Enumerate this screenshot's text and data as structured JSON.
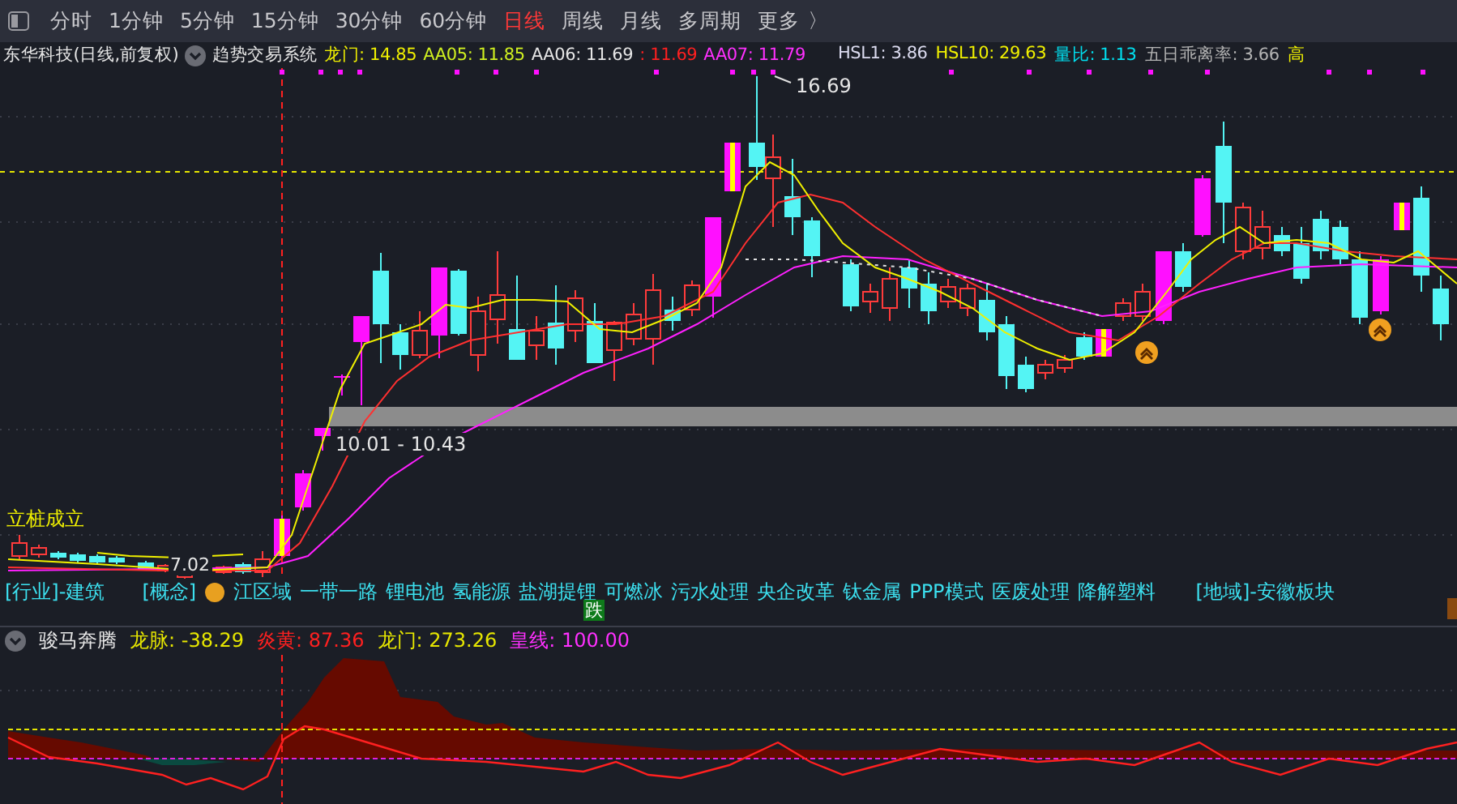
{
  "toolbar": {
    "items": [
      {
        "label": "分时",
        "selected": false
      },
      {
        "label": "1分钟",
        "selected": false
      },
      {
        "label": "5分钟",
        "selected": false
      },
      {
        "label": "15分钟",
        "selected": false
      },
      {
        "label": "30分钟",
        "selected": false
      },
      {
        "label": "60分钟",
        "selected": false
      },
      {
        "label": "日线",
        "selected": true
      },
      {
        "label": "周线",
        "selected": false
      },
      {
        "label": "月线",
        "selected": false
      },
      {
        "label": "多周期",
        "selected": false
      },
      {
        "label": "更多",
        "selected": false
      }
    ],
    "more_caret": "〉"
  },
  "legend": {
    "title": "东华科技(日线,前复权)",
    "system": "趋势交易系统",
    "values": [
      {
        "text": "龙门: 14.85",
        "color": "#f0f000"
      },
      {
        "text": "AA05: 11.85",
        "color": "#d0f020"
      },
      {
        "text": "AA06: 11.69",
        "color": "#e6e6e6"
      },
      {
        "text": ": 11.69",
        "color": "#ff2020"
      },
      {
        "text": "AA07: 11.79",
        "color": "#ff30ff"
      }
    ],
    "stats": [
      {
        "text": "HSL1: 3.86",
        "color": "#dcdcf0"
      },
      {
        "text": "HSL10: 29.63",
        "color": "#f0f000"
      },
      {
        "text": "量比: 1.13",
        "color": "#00e0f0"
      },
      {
        "text": "五日乖离率: 3.66",
        "color": "#b4b4b4"
      },
      {
        "text": "高",
        "color": "#f0f000"
      }
    ]
  },
  "chart": {
    "high_label": "16.69",
    "range_label": "10.01 - 10.43",
    "signal_label": "立桩成立",
    "low_label": "7.02"
  },
  "tags": {
    "industry": "[行业]-建筑",
    "concept_head": "[概念]",
    "concepts": [
      "江区域",
      "一带一路",
      "锂电池",
      "氢能源",
      "盐湖提锂",
      "可燃冰",
      "污水处理",
      "央企改革",
      "钛金属",
      "PPP模式",
      "医废处理",
      "降解塑料"
    ],
    "region": "[地域]-安徽板块",
    "fall_badge": "跌"
  },
  "indicator": {
    "title": "骏马奔腾",
    "values": [
      {
        "text": "龙脉: -38.29",
        "color": "#e6e600"
      },
      {
        "text": "炎黄: 87.36",
        "color": "#ff2020"
      },
      {
        "text": "龙门: 273.26",
        "color": "#e6e600"
      },
      {
        "text": "皇线: 100.00",
        "color": "#ff30ff"
      }
    ]
  }
}
